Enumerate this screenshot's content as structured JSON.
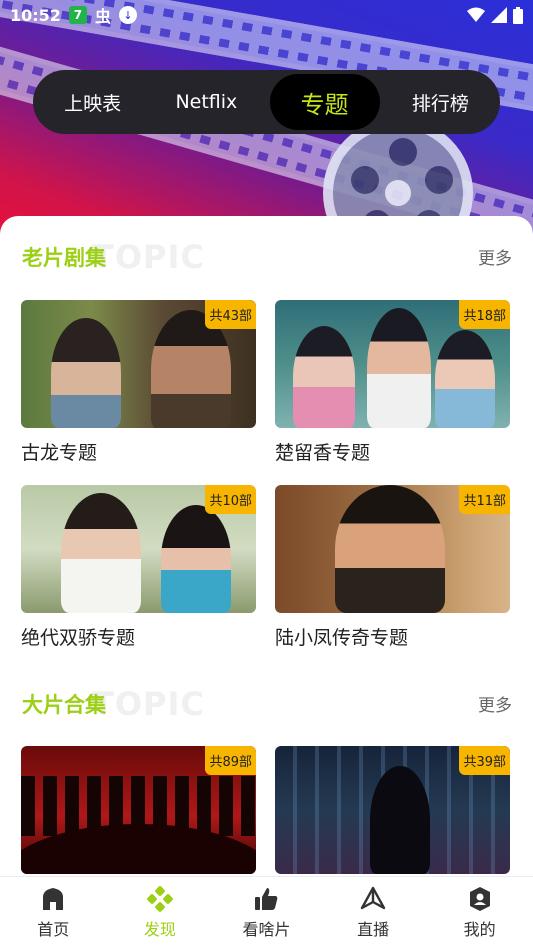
{
  "status_bar": {
    "time": "10:52",
    "badge": "7",
    "glyph": "虫"
  },
  "tabs": [
    {
      "label": "上映表",
      "active": false
    },
    {
      "label": "Netflix",
      "active": false
    },
    {
      "label": "专题",
      "active": true
    },
    {
      "label": "排行榜",
      "active": false
    }
  ],
  "sections": [
    {
      "title": "老片剧集",
      "watermark": "TOPIC",
      "more": "更多",
      "cards": [
        {
          "title": "古龙专题",
          "count": "共43部"
        },
        {
          "title": "楚留香专题",
          "count": "共18部"
        },
        {
          "title": "绝代双骄专题",
          "count": "共10部"
        },
        {
          "title": "陆小凤传奇专题",
          "count": "共11部"
        }
      ]
    },
    {
      "title": "大片合集",
      "watermark": "TOPIC",
      "more": "更多",
      "cards": [
        {
          "title": "",
          "count": "共89部"
        },
        {
          "title": "",
          "count": "共39部"
        }
      ]
    }
  ],
  "bottom_nav": [
    {
      "label": "首页",
      "icon": "home-icon",
      "active": false
    },
    {
      "label": "发现",
      "icon": "discover-icon",
      "active": true
    },
    {
      "label": "看啥片",
      "icon": "thumbs-up-icon",
      "active": false
    },
    {
      "label": "直播",
      "icon": "live-icon",
      "active": false
    },
    {
      "label": "我的",
      "icon": "profile-icon",
      "active": false
    }
  ],
  "colors": {
    "accent": "#9ccf16",
    "active_tab_text": "#c6e51b",
    "badge_bg": "#f7b500"
  }
}
